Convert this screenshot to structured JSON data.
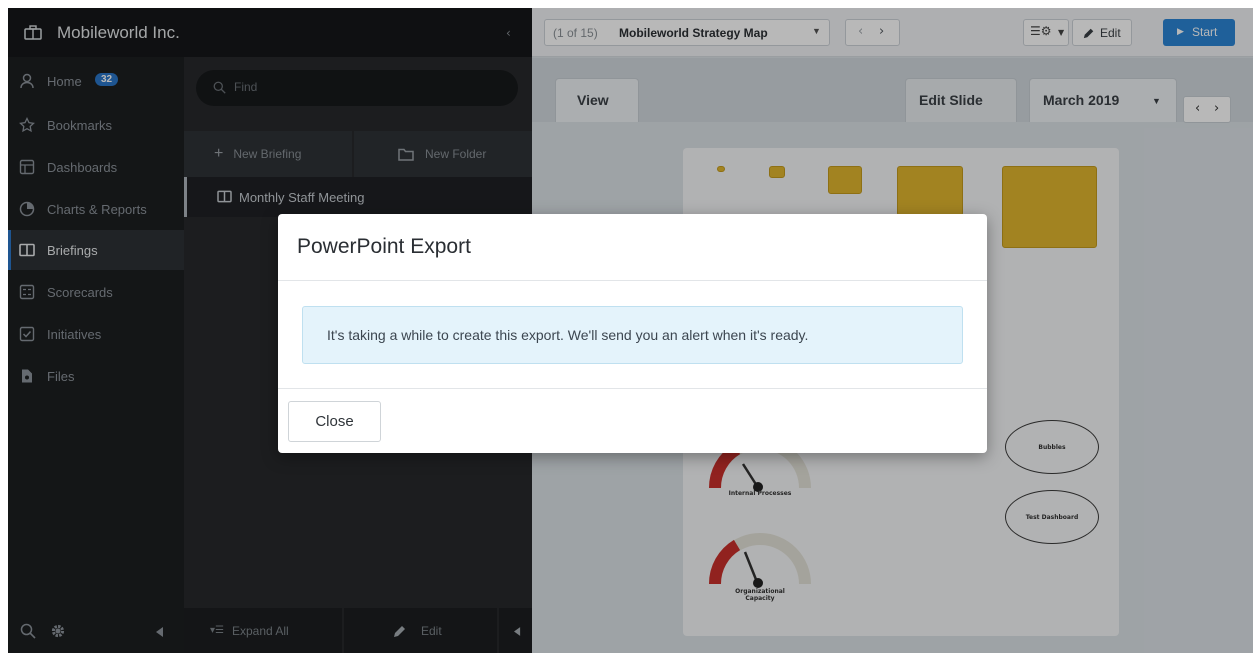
{
  "org": {
    "name": "Mobileworld Inc.",
    "collapse_glyph": "‹"
  },
  "nav": {
    "items": [
      {
        "label": "Home",
        "icon": "home-icon",
        "badge": "32"
      },
      {
        "label": "Bookmarks",
        "icon": "star-icon"
      },
      {
        "label": "Dashboards",
        "icon": "dashboard-icon"
      },
      {
        "label": "Charts & Reports",
        "icon": "chart-icon"
      },
      {
        "label": "Briefings",
        "icon": "book-icon",
        "active": true
      },
      {
        "label": "Scorecards",
        "icon": "scorecard-icon"
      },
      {
        "label": "Initiatives",
        "icon": "checkbox-icon"
      },
      {
        "label": "Files",
        "icon": "files-icon"
      }
    ]
  },
  "briefings": {
    "search_placeholder": "Find",
    "new_briefing": "New Briefing",
    "new_folder": "New Folder",
    "list": [
      {
        "label": "Monthly Staff Meeting"
      }
    ],
    "expand_all": "Expand All",
    "edit": "Edit"
  },
  "topbar": {
    "map_counter": "(1 of 15)",
    "map_name": "Mobileworld Strategy Map",
    "edit_label": "Edit",
    "start_label": "Start"
  },
  "tabs": {
    "view": "View",
    "edit_slide": "Edit Slide",
    "period": "March 2019"
  },
  "canvas": {
    "box_labels": [
      "--",
      "--",
      "--",
      "--",
      "--"
    ],
    "gauges": [
      {
        "label": "Internal Processes"
      },
      {
        "label": "Organizational Capacity"
      }
    ],
    "bubbles": [
      {
        "label": "Bubbles"
      },
      {
        "label": "Test Dashboard"
      }
    ]
  },
  "modal": {
    "title": "PowerPoint Export",
    "message": "It's taking a while to create this export. We'll send you an alert when it's ready.",
    "close_label": "Close"
  },
  "colors": {
    "accent": "#2a77c9",
    "start": "#2b86d6",
    "gauge_red": "#c9302c",
    "box_yellow": "#e1b62f",
    "alert_bg": "#e4f3fb"
  }
}
